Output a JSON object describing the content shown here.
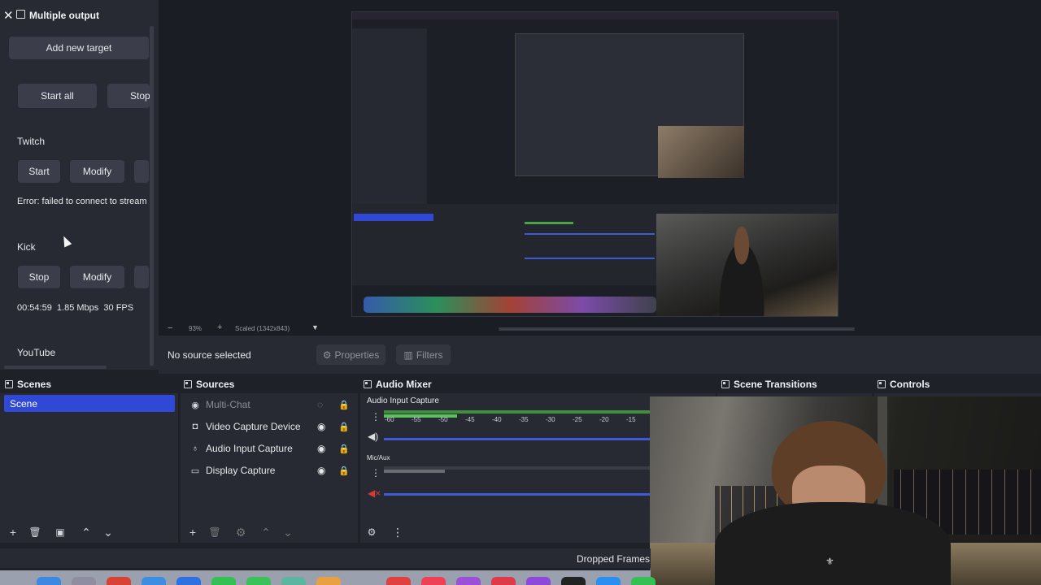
{
  "multiple_output": {
    "title": "Multiple output",
    "add_target": "Add new target",
    "start_all": "Start all",
    "stop_all": "Stop",
    "targets": [
      {
        "name": "Twitch",
        "action": "Start",
        "modify": "Modify",
        "status": "Error: failed to connect to stream"
      },
      {
        "name": "Kick",
        "action": "Stop",
        "modify": "Modify",
        "status": "00:54:59  1.85 Mbps  30 FPS"
      },
      {
        "name": "YouTube"
      }
    ]
  },
  "preview": {
    "zoom": "93%",
    "scale_mode": "Scaled (1342x843)"
  },
  "context_bar": {
    "no_source": "No source selected",
    "properties": "Properties",
    "filters": "Filters"
  },
  "docks": {
    "scenes": "Scenes",
    "sources": "Sources",
    "audio_mixer": "Audio Mixer",
    "scene_transitions": "Scene Transitions",
    "controls": "Controls"
  },
  "scenes": [
    "Scene"
  ],
  "sources": [
    {
      "name": "Multi-Chat",
      "icon": "browser-icon",
      "hidden": true
    },
    {
      "name": "Video Capture Device",
      "icon": "camera-icon",
      "hidden": false
    },
    {
      "name": "Audio Input Capture",
      "icon": "microphone-icon",
      "hidden": false
    },
    {
      "name": "Display Capture",
      "icon": "monitor-icon",
      "hidden": false
    }
  ],
  "mixer": {
    "channels": [
      {
        "name": "Audio Input Capture",
        "muted": false
      },
      {
        "name": "Mic/Aux",
        "muted": true
      }
    ],
    "scale": [
      "-60",
      "-55",
      "-50",
      "-45",
      "-40",
      "-35",
      "-30",
      "-25",
      "-20",
      "-15"
    ]
  },
  "status_bar": {
    "dropped_frames": "Dropped Frames 0"
  },
  "colors": {
    "accent": "#2f48d6",
    "panel": "#272a33",
    "button": "#3b3e4a",
    "meter_green": "#4aa34a",
    "meter_blue": "#3e5ad6"
  }
}
